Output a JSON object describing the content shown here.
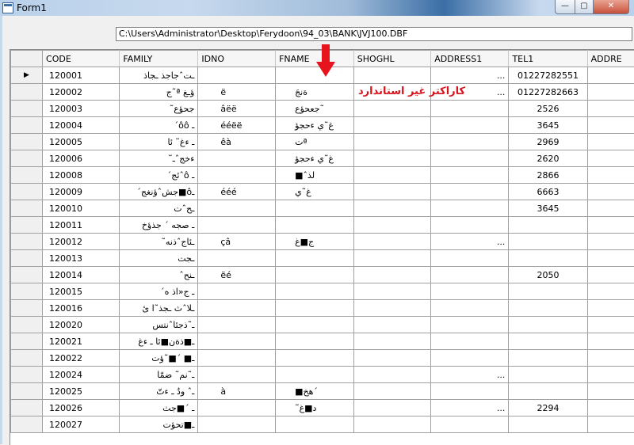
{
  "window": {
    "title": "Form1",
    "minimize_label": "—",
    "maximize_label": "▢",
    "close_label": "✕"
  },
  "path_field": {
    "value": "C:\\Users\\Administrator\\Desktop\\Ferydoon\\94_03\\BANK\\JVJ100.DBF"
  },
  "annotation": {
    "text": "کاراکتر غیر استاندارد",
    "color": "#d9131b"
  },
  "grid": {
    "current_row_marker": "▶",
    "columns": [
      "CODE",
      "FAMILY",
      "IDNO",
      "FNAME",
      "SHOGHL",
      "ADDRESS1",
      "TEL1",
      "ADDRE"
    ],
    "rows": [
      {
        "code": "120001",
        "family": "ـتˆجاجذ ـجاذ",
        "idno": "",
        "fname": "",
        "shoghl": "",
        "address1": "...",
        "tel1": "01227282551"
      },
      {
        "code": "120002",
        "family": "ؤـغ ª˜ج",
        "idno": "ë",
        "fname": "ةنجَ",
        "shoghl": "",
        "address1": "...",
        "tel1": "01227282663"
      },
      {
        "code": "120003",
        "family": "جحؤع˜",
        "idno": "âëë",
        "fname": "جعحؤع˜",
        "shoghl": "",
        "address1": "",
        "tel1": "2526"
      },
      {
        "code": "120004",
        "family": "ـ ôôˊ",
        "idno": "ééëë",
        "fname": "غ˜ي ءحجؤ",
        "shoghl": "",
        "address1": "",
        "tel1": "3645"
      },
      {
        "code": "120005",
        "family": "ـ ءغ˜ ئا",
        "idno": "êà",
        "fname": "تª",
        "shoghl": "",
        "address1": "",
        "tel1": "2969"
      },
      {
        "code": "120006",
        "family": "ءخجˆـ˜",
        "idno": "",
        "fname": "غ˜ي ءحجؤ",
        "shoghl": "",
        "address1": "",
        "tel1": "2620"
      },
      {
        "code": "120008",
        "family": "ـ ôˆئجˊ",
        "idno": "",
        "fname": "■ˆلذ",
        "shoghl": "",
        "address1": "",
        "tel1": "2866"
      },
      {
        "code": "120009",
        "family": "ـô■جشˆؤنغجˊ",
        "idno": "ééé",
        "fname": "غ˜ي",
        "shoghl": "",
        "address1": "",
        "tel1": "6663"
      },
      {
        "code": "120010",
        "family": "ـحˆت",
        "idno": "",
        "fname": "",
        "shoghl": "",
        "address1": "",
        "tel1": "3645"
      },
      {
        "code": "120011",
        "family": "ـ صجه ˊ جذؤخ",
        "idno": "",
        "fname": "",
        "shoghl": "",
        "address1": "",
        "tel1": ""
      },
      {
        "code": "120012",
        "family": "ـئاجˆذنه˜",
        "idno": "çâ",
        "fname": "ج■غ",
        "shoghl": "",
        "address1": "...",
        "tel1": ""
      },
      {
        "code": "120013",
        "family": "ـجت",
        "idno": "",
        "fname": "",
        "shoghl": "",
        "address1": "",
        "tel1": ""
      },
      {
        "code": "120014",
        "family": "ـنحˆ",
        "idno": "ëé",
        "fname": "",
        "shoghl": "",
        "address1": "",
        "tel1": "2050"
      },
      {
        "code": "120015",
        "family": "ـ ج«اذ هˊ",
        "idno": "",
        "fname": "",
        "shoghl": "",
        "address1": "",
        "tel1": ""
      },
      {
        "code": "120016",
        "family": "ـلاˆث ـجذ˜ا ئ",
        "idno": "",
        "fname": "",
        "shoghl": "",
        "address1": "",
        "tel1": ""
      },
      {
        "code": "120020",
        "family": "ـ˜ذجئاˆنتس",
        "idno": "",
        "fname": "",
        "shoghl": "",
        "address1": "",
        "tel1": ""
      },
      {
        "code": "120021",
        "family": "ـ■ذةن■ئا ـ ءغ",
        "idno": "",
        "fname": "",
        "shoghl": "",
        "address1": "",
        "tel1": ""
      },
      {
        "code": "120022",
        "family": "ـ■ ˊ■˜ؤت",
        "idno": "",
        "fname": "",
        "shoghl": "",
        "address1": "",
        "tel1": ""
      },
      {
        "code": "120024",
        "family": "ـ˜نم˜ ضمّا",
        "idno": "",
        "fname": "",
        "shoghl": "",
        "address1": "...",
        "tel1": ""
      },
      {
        "code": "120025",
        "family": "ـˆ ودُ ـ ءتّ",
        "idno": "à",
        "fname": "■هخˊ",
        "shoghl": "",
        "address1": "",
        "tel1": ""
      },
      {
        "code": "120026",
        "family": "ـ ˊ■جث",
        "idno": "",
        "fname": "˜د■غ",
        "shoghl": "",
        "address1": "...",
        "tel1": "2294"
      },
      {
        "code": "120027",
        "family": "ـ■تحؤت",
        "idno": "",
        "fname": "",
        "shoghl": "",
        "address1": "",
        "tel1": ""
      }
    ]
  }
}
